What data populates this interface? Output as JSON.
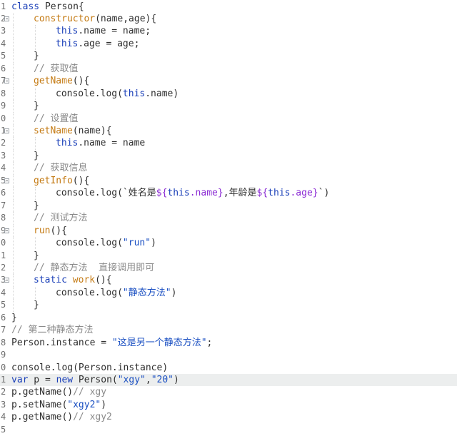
{
  "gutter_numbers": [
    "1",
    "2",
    "3",
    "4",
    "5",
    "6",
    "7",
    "8",
    "9",
    "0",
    "1",
    "2",
    "3",
    "4",
    "5",
    "6",
    "7",
    "8",
    "9",
    "0",
    "1",
    "2",
    "3",
    "4",
    "5",
    "6",
    "7",
    "8",
    "9",
    "0",
    "1",
    "2",
    "3",
    "4",
    "5"
  ],
  "lines": [
    {
      "n": "1",
      "indent": 0,
      "fold": false,
      "tokens": [
        {
          "c": "k",
          "t": "class"
        },
        {
          "c": "p",
          "t": " Person{"
        }
      ]
    },
    {
      "n": "2",
      "indent": 1,
      "fold": true,
      "tokens": [
        {
          "c": "f",
          "t": "constructor"
        },
        {
          "c": "p",
          "t": "(name,age){"
        }
      ]
    },
    {
      "n": "3",
      "indent": 2,
      "fold": false,
      "tokens": [
        {
          "c": "t",
          "t": "this"
        },
        {
          "c": "p",
          "t": ".name = name;"
        }
      ]
    },
    {
      "n": "4",
      "indent": 2,
      "fold": false,
      "tokens": [
        {
          "c": "t",
          "t": "this"
        },
        {
          "c": "p",
          "t": ".age = age;"
        }
      ]
    },
    {
      "n": "5",
      "indent": 1,
      "fold": false,
      "tokens": [
        {
          "c": "p",
          "t": "}"
        }
      ]
    },
    {
      "n": "6",
      "indent": 1,
      "fold": false,
      "tokens": [
        {
          "c": "c",
          "t": "// 获取值"
        }
      ]
    },
    {
      "n": "7",
      "indent": 1,
      "fold": true,
      "tokens": [
        {
          "c": "f",
          "t": "getName"
        },
        {
          "c": "p",
          "t": "(){"
        }
      ]
    },
    {
      "n": "8",
      "indent": 2,
      "fold": false,
      "tokens": [
        {
          "c": "p",
          "t": "console.log("
        },
        {
          "c": "t",
          "t": "this"
        },
        {
          "c": "p",
          "t": ".name)"
        }
      ]
    },
    {
      "n": "9",
      "indent": 1,
      "fold": false,
      "tokens": [
        {
          "c": "p",
          "t": "}"
        }
      ]
    },
    {
      "n": "0",
      "indent": 1,
      "fold": false,
      "tokens": [
        {
          "c": "c",
          "t": "// 设置值"
        }
      ]
    },
    {
      "n": "1",
      "indent": 1,
      "fold": true,
      "tokens": [
        {
          "c": "f",
          "t": "setName"
        },
        {
          "c": "p",
          "t": "(name){"
        }
      ]
    },
    {
      "n": "2",
      "indent": 2,
      "fold": false,
      "tokens": [
        {
          "c": "t",
          "t": "this"
        },
        {
          "c": "p",
          "t": ".name = name"
        }
      ]
    },
    {
      "n": "3",
      "indent": 1,
      "fold": false,
      "tokens": [
        {
          "c": "p",
          "t": "}"
        }
      ]
    },
    {
      "n": "4",
      "indent": 1,
      "fold": false,
      "tokens": [
        {
          "c": "c",
          "t": "// 获取信息"
        }
      ]
    },
    {
      "n": "5",
      "indent": 1,
      "fold": true,
      "tokens": [
        {
          "c": "f",
          "t": "getInfo"
        },
        {
          "c": "p",
          "t": "(){"
        }
      ]
    },
    {
      "n": "6",
      "indent": 2,
      "fold": false,
      "tokens": [
        {
          "c": "p",
          "t": "console.log(`姓名是"
        },
        {
          "c": "i",
          "t": "${"
        },
        {
          "c": "t",
          "t": "this"
        },
        {
          "c": "i",
          "t": ".name}"
        },
        {
          "c": "p",
          "t": ",年龄是"
        },
        {
          "c": "i",
          "t": "${"
        },
        {
          "c": "t",
          "t": "this"
        },
        {
          "c": "i",
          "t": ".age}"
        },
        {
          "c": "p",
          "t": "`)"
        }
      ]
    },
    {
      "n": "7",
      "indent": 1,
      "fold": false,
      "tokens": [
        {
          "c": "p",
          "t": "}"
        }
      ]
    },
    {
      "n": "8",
      "indent": 1,
      "fold": false,
      "tokens": [
        {
          "c": "c",
          "t": "// 测试方法"
        }
      ]
    },
    {
      "n": "9",
      "indent": 1,
      "fold": true,
      "tokens": [
        {
          "c": "f",
          "t": "run"
        },
        {
          "c": "p",
          "t": "(){"
        }
      ]
    },
    {
      "n": "0",
      "indent": 2,
      "fold": false,
      "tokens": [
        {
          "c": "p",
          "t": "console.log("
        },
        {
          "c": "s",
          "t": "\"run\""
        },
        {
          "c": "p",
          "t": ")"
        }
      ]
    },
    {
      "n": "1",
      "indent": 1,
      "fold": false,
      "tokens": [
        {
          "c": "p",
          "t": "}"
        }
      ]
    },
    {
      "n": "2",
      "indent": 1,
      "fold": false,
      "tokens": [
        {
          "c": "c",
          "t": "// 静态方法  直接调用即可"
        }
      ]
    },
    {
      "n": "3",
      "indent": 1,
      "fold": true,
      "tokens": [
        {
          "c": "k",
          "t": "static"
        },
        {
          "c": "p",
          "t": " "
        },
        {
          "c": "f",
          "t": "work"
        },
        {
          "c": "p",
          "t": "(){"
        }
      ]
    },
    {
      "n": "4",
      "indent": 2,
      "fold": false,
      "tokens": [
        {
          "c": "p",
          "t": "console.log("
        },
        {
          "c": "s",
          "t": "\"静态方法\""
        },
        {
          "c": "p",
          "t": ")"
        }
      ]
    },
    {
      "n": "5",
      "indent": 1,
      "fold": false,
      "tokens": [
        {
          "c": "p",
          "t": "}"
        }
      ]
    },
    {
      "n": "6",
      "indent": 0,
      "fold": false,
      "tokens": [
        {
          "c": "p",
          "t": "}"
        }
      ]
    },
    {
      "n": "7",
      "indent": 0,
      "fold": false,
      "tokens": [
        {
          "c": "c",
          "t": "// 第二种静态方法"
        }
      ]
    },
    {
      "n": "8",
      "indent": 0,
      "fold": false,
      "tokens": [
        {
          "c": "p",
          "t": "Person.instance = "
        },
        {
          "c": "s",
          "t": "\"这是另一个静态方法\""
        },
        {
          "c": "p",
          "t": ";"
        }
      ]
    },
    {
      "n": "9",
      "indent": 0,
      "fold": false,
      "tokens": []
    },
    {
      "n": "0",
      "indent": 0,
      "fold": false,
      "tokens": [
        {
          "c": "p",
          "t": "console.log(Person.instance)"
        }
      ]
    },
    {
      "n": "1",
      "indent": 0,
      "fold": false,
      "current": true,
      "tokens": [
        {
          "c": "k",
          "t": "var"
        },
        {
          "c": "p",
          "t": " p = "
        },
        {
          "c": "k",
          "t": "new"
        },
        {
          "c": "p",
          "t": " Person("
        },
        {
          "c": "s",
          "t": "\"xgy\""
        },
        {
          "c": "p",
          "t": ","
        },
        {
          "c": "s",
          "t": "\"20\""
        },
        {
          "c": "p",
          "t": ")"
        }
      ]
    },
    {
      "n": "2",
      "indent": 0,
      "fold": false,
      "tokens": [
        {
          "c": "p",
          "t": "p.getName()"
        },
        {
          "c": "c",
          "t": "// xgy"
        }
      ]
    },
    {
      "n": "3",
      "indent": 0,
      "fold": false,
      "tokens": [
        {
          "c": "p",
          "t": "p.setName("
        },
        {
          "c": "s",
          "t": "\"xgy2\""
        },
        {
          "c": "p",
          "t": ")"
        }
      ]
    },
    {
      "n": "4",
      "indent": 0,
      "fold": false,
      "tokens": [
        {
          "c": "p",
          "t": "p.getName()"
        },
        {
          "c": "c",
          "t": "// xgy2"
        }
      ]
    },
    {
      "n": "5",
      "indent": 0,
      "fold": false,
      "tokens": []
    }
  ],
  "colors": {
    "keyword": "#1a3fb8",
    "function": "#c47a13",
    "string": "#1a4fc2",
    "comment": "#8a8a8a",
    "interpolation": "#8b2bd4",
    "current_line": "#eceeee"
  }
}
